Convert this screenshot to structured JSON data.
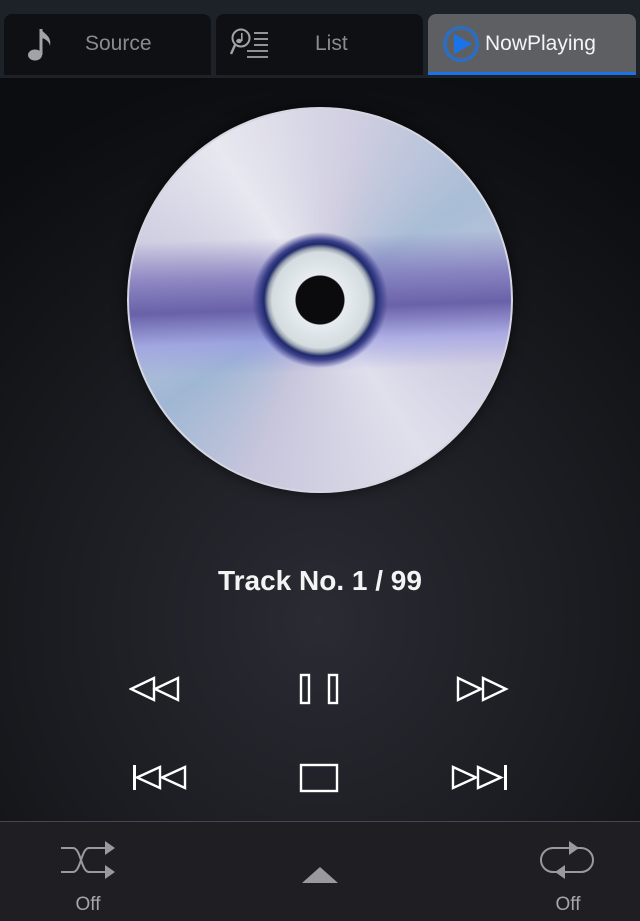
{
  "tabs": [
    {
      "id": "source",
      "label": "Source",
      "icon": "music-note-icon",
      "active": false
    },
    {
      "id": "list",
      "label": "List",
      "icon": "search-list-icon",
      "active": false
    },
    {
      "id": "nowplaying",
      "label": "NowPlaying",
      "icon": "play-circle-icon",
      "active": true
    }
  ],
  "colors": {
    "accent": "#1a73e8",
    "active_tab_bg": "#5d5f63",
    "inactive_tab_bg": "#0e1014"
  },
  "now_playing": {
    "artwork": "cd-disc-image",
    "track_label": "Track No. 1 / 99",
    "track_number": 1,
    "track_total": 99
  },
  "controls": {
    "row1": [
      "rewind",
      "pause",
      "fast-forward"
    ],
    "row2": [
      "previous-track",
      "stop",
      "next-track"
    ]
  },
  "bottom": {
    "shuffle": {
      "icon": "shuffle-icon",
      "state": "Off"
    },
    "expand": {
      "icon": "chevron-up-icon"
    },
    "repeat": {
      "icon": "repeat-icon",
      "state": "Off"
    }
  }
}
